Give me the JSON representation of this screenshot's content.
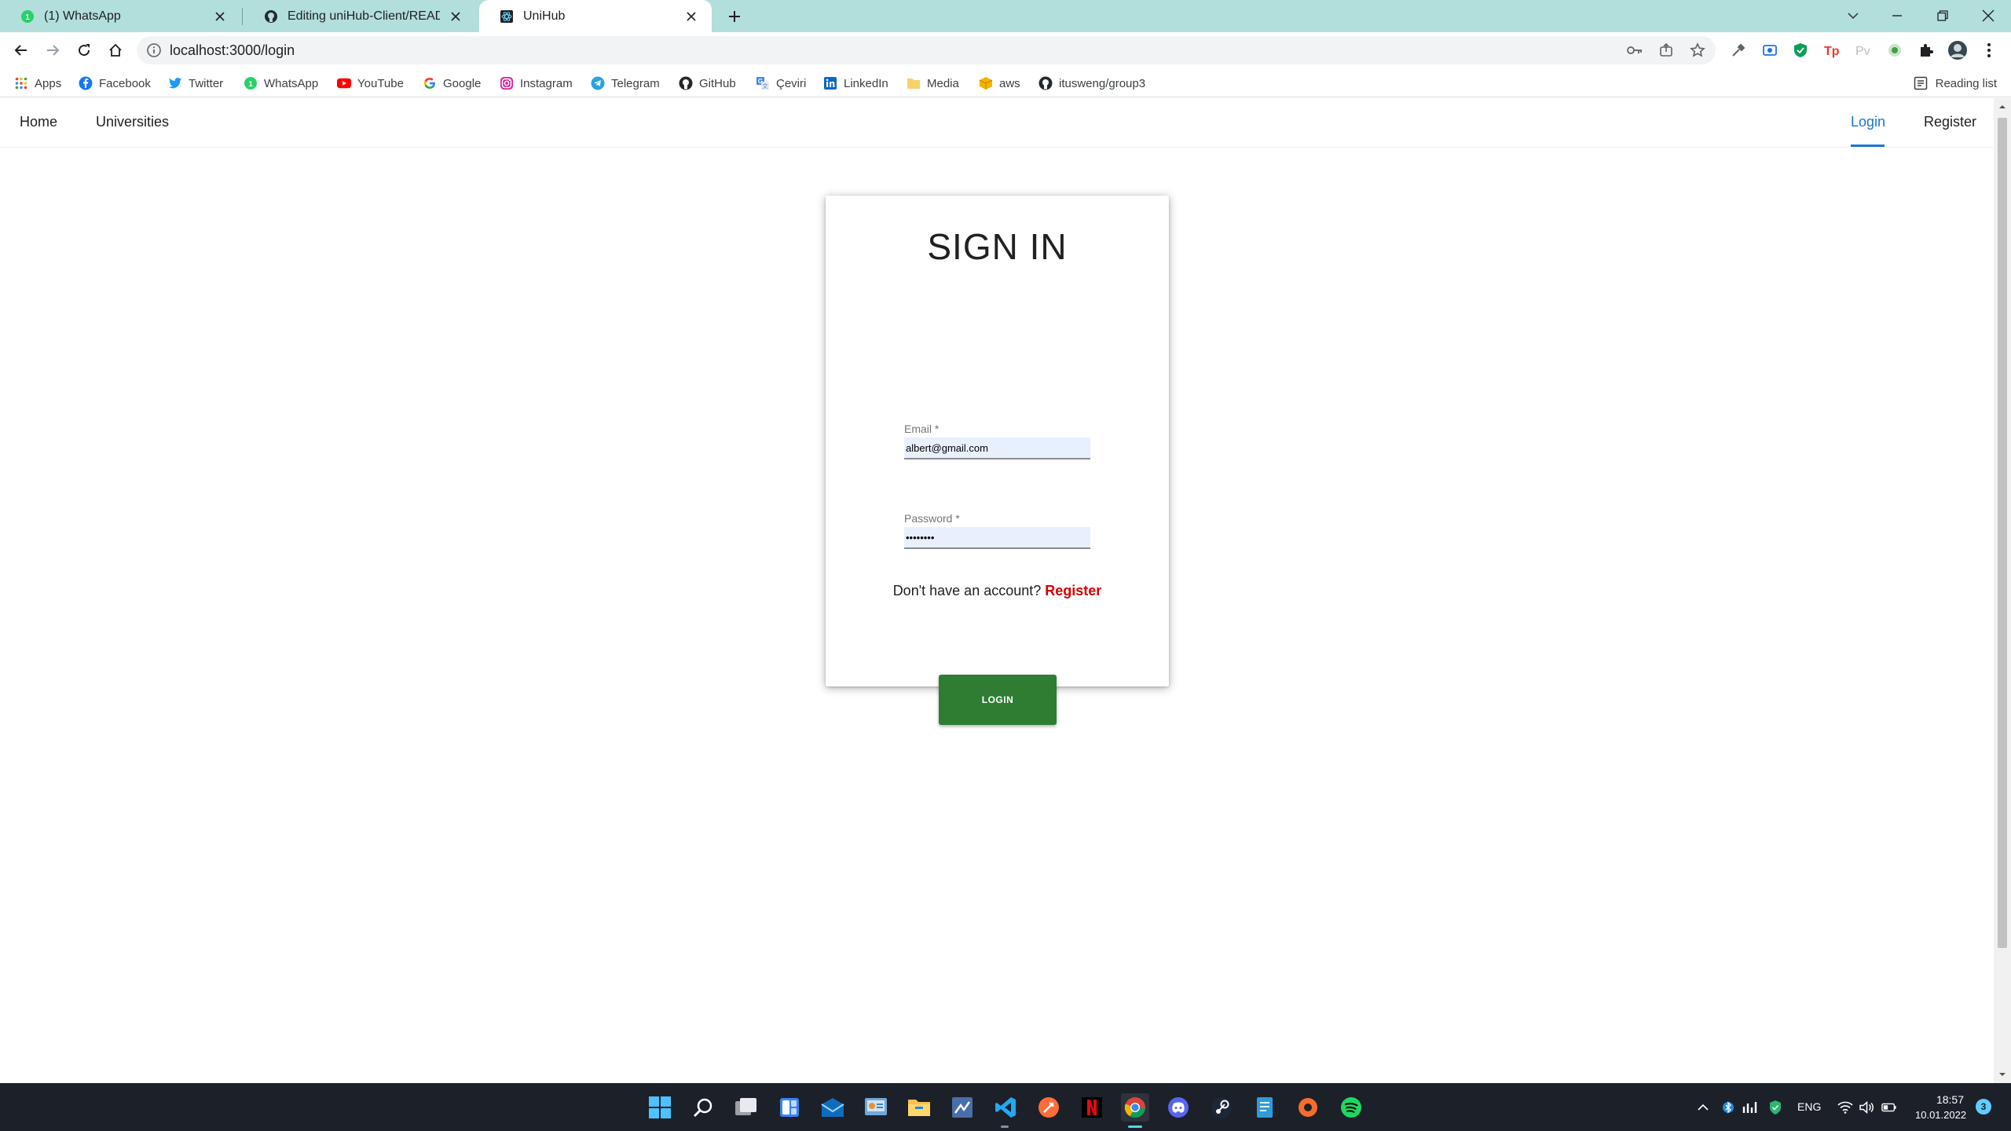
{
  "browser": {
    "tabs": [
      {
        "title": "(1) WhatsApp",
        "favicon": "whatsapp-icon"
      },
      {
        "title": "Editing uniHub-Client/README.md",
        "favicon": "github-icon"
      },
      {
        "title": "UniHub",
        "favicon": "react-icon",
        "active": true
      }
    ],
    "url": "localhost:3000/login",
    "bookmarks": [
      {
        "label": "Apps"
      },
      {
        "label": "Facebook"
      },
      {
        "label": "Twitter"
      },
      {
        "label": "WhatsApp"
      },
      {
        "label": "YouTube"
      },
      {
        "label": "Google"
      },
      {
        "label": "Instagram"
      },
      {
        "label": "Telegram"
      },
      {
        "label": "GitHub"
      },
      {
        "label": "Çeviri"
      },
      {
        "label": "LinkedIn"
      },
      {
        "label": "Media"
      },
      {
        "label": "aws"
      },
      {
        "label": "itusweng/group3"
      }
    ],
    "reading_list": "Reading list"
  },
  "app_nav": {
    "left": [
      {
        "label": "Home"
      },
      {
        "label": "Universities"
      }
    ],
    "right": [
      {
        "label": "Login",
        "active": true
      },
      {
        "label": "Register"
      }
    ]
  },
  "signin": {
    "title": "SIGN IN",
    "email_label": "Email",
    "email_value": "albert@gmail.com",
    "password_label": "Password",
    "password_value": "albert12",
    "required_mark": "*",
    "no_account_text": "Don't have an account?",
    "register_link": "Register",
    "login_button": "LOGIN"
  },
  "taskbar": {
    "language": "ENG",
    "time": "18:57",
    "date": "10.01.2022",
    "notifications": "3"
  },
  "colors": {
    "tab_strip": "#b2dfdb",
    "nav_active": "#1976d2",
    "register_link": "#d50000",
    "login_button": "#2e7d32",
    "taskbar": "#1c2029"
  }
}
